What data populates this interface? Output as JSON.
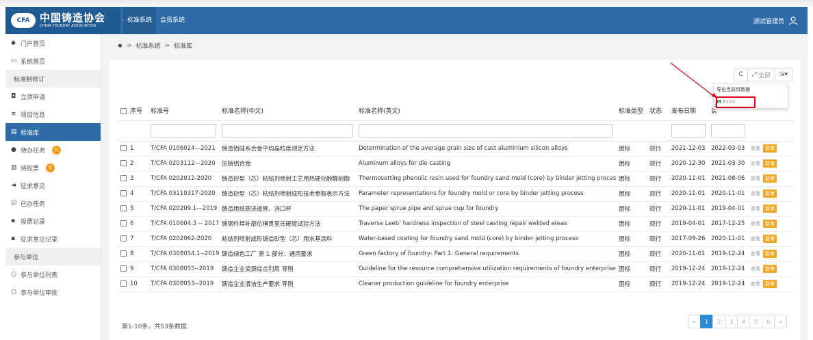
{
  "header": {
    "logo_mark": "CFA",
    "logo_cn": "中国铸造协会",
    "logo_en": "CHINA FOUNDRY ASSOCIATION",
    "collapse": "«",
    "nav": [
      "标准系统",
      "会员系统"
    ],
    "user": "测试管理员"
  },
  "sidebar": {
    "items": [
      {
        "label": "门户首页",
        "icon": "home-icon",
        "glyph": "◆"
      },
      {
        "label": "系统首页",
        "icon": "monitor-icon",
        "glyph": "▭"
      },
      {
        "label": "标准制修订",
        "group": true
      },
      {
        "label": "立项申请",
        "icon": "file-icon",
        "glyph": "◘"
      },
      {
        "label": "项目信息",
        "icon": "list-icon",
        "glyph": "≡"
      },
      {
        "label": "标准库",
        "icon": "book-icon",
        "glyph": "▤",
        "active": true
      },
      {
        "label": "待办任务",
        "icon": "info-icon",
        "glyph": "●",
        "badge": "0"
      },
      {
        "label": "待投票",
        "icon": "bar-chart-icon",
        "glyph": "▥",
        "badge": "0"
      },
      {
        "label": "征求意见",
        "icon": "send-icon",
        "glyph": "◄"
      },
      {
        "label": "已办任务",
        "icon": "check-icon",
        "glyph": "☑"
      },
      {
        "label": "投票记录",
        "icon": "doc-icon",
        "glyph": "▪"
      },
      {
        "label": "征求意见记录",
        "icon": "doc-icon",
        "glyph": "▪"
      },
      {
        "label": "参与单位",
        "group": true
      },
      {
        "label": "参与单位列表",
        "icon": "circle-icon",
        "glyph": "○"
      },
      {
        "label": "参与单位审批",
        "icon": "circle-icon",
        "glyph": "○"
      }
    ]
  },
  "breadcrumb": {
    "home_icon": "◆",
    "sep": ">",
    "items": [
      "标准系统",
      "标准库"
    ]
  },
  "toolbar": {
    "refresh": "C",
    "toggle_all": "全部",
    "export_glyph": "▾"
  },
  "dropdown": {
    "export_current": "导出当前页数据",
    "excel": "Excel",
    "excel_mark": "M",
    "marker": "3"
  },
  "table": {
    "headers": {
      "index": "序号",
      "code": "标准号",
      "name_cn": "标准名称(中文)",
      "name_en": "标准名称(英文)",
      "type": "标准类型",
      "status": "状态",
      "release": "发布日期",
      "implement": "实"
    },
    "view_label": "查看",
    "revise_label": "复审",
    "rows": [
      {
        "index": "1",
        "code": "T/CFA 0106024—2021",
        "name_cn": "铸造铝硅系合金平均晶粒度测定方法",
        "name_en": "Determination of the average grain size of cast aluminium silicon alloys",
        "type": "团标",
        "status": "现行",
        "release": "2021-12-03",
        "implement": "2022-03-03"
      },
      {
        "index": "2",
        "code": "T/CFA 0203112—2020",
        "name_cn": "压铸铝合金",
        "name_en": "Aluminum alloys for die casting",
        "type": "团标",
        "status": "现行",
        "release": "2020-12-30",
        "implement": "2021-03-30"
      },
      {
        "index": "3",
        "code": "T/CFA 0202012-2020",
        "name_cn": "铸造砂型（芯）粘结剂喷射工艺用热硬化酚醛树脂",
        "name_en": "Thermosetting phenolic resin used for foundry sand mold (core) by binder jetting process",
        "type": "团标",
        "status": "现行",
        "release": "2020-11-01",
        "implement": "2021-08-06"
      },
      {
        "index": "4",
        "code": "T/CFA 03110317-2020",
        "name_cn": "铸造砂型（芯）粘结剂喷射成形技术参数表示方法",
        "name_en": "Parameter representations for foundry mold or core by binder jetting process",
        "type": "团标",
        "status": "现行",
        "release": "2020-11-01",
        "implement": "2020-11-01"
      },
      {
        "index": "5",
        "code": "T/CFA 020209.1—2019",
        "name_cn": "铸造用纸质浇道管、浇口杯",
        "name_en": "The paper sprue pipe and sprue cup for foundry",
        "type": "团标",
        "status": "现行",
        "release": "2020-11-01",
        "implement": "2019-04-01"
      },
      {
        "index": "6",
        "code": "T/CFA 010604.3 -- 2017",
        "name_cn": "铸钢件焊补部位横贯里氏硬度试验方法",
        "name_en": "Traverse Leeb’ hardness inspection of steel casting repair welded areas",
        "type": "团标",
        "status": "现行",
        "release": "2019-04-01",
        "implement": "2017-12-25"
      },
      {
        "index": "7",
        "code": "T/CFA 0202062-2020",
        "name_cn": "粘结剂喷射成形铸造砂型（芯）用水基涂料",
        "name_en": "Water-based coating for foundry sand mold (core) by binder jetting process",
        "type": "团标",
        "status": "现行",
        "release": "2017-09-26",
        "implement": "2020-11-01"
      },
      {
        "index": "8",
        "code": "T/CFA 0308054.1--2019",
        "name_cn": "铸造绿色工厂 第 1 部分：通用要求",
        "name_en": "Green factory of foundry- Part 1: General requirements",
        "type": "团标",
        "status": "现行",
        "release": "2020-11-01",
        "implement": "2019-12-24"
      },
      {
        "index": "9",
        "code": "T/CFA 0308055--2019",
        "name_cn": "铸造企业资源综合利用 导则",
        "name_en": "Guideline for the resource comprehensive utilization requirements of foundry enterprises",
        "type": "团标",
        "status": "现行",
        "release": "2019-12-24",
        "implement": "2019-12-24"
      },
      {
        "index": "10",
        "code": "T/CFA 0308053--2019",
        "name_cn": "铸造企业清洁生产要求 导则",
        "name_en": "Cleaner production guideline for foundry enterprise",
        "type": "团标",
        "status": "现行",
        "release": "2019-12-24",
        "implement": "2019-12-24"
      }
    ]
  },
  "footer": {
    "range": "第1-10条，共53条数据.",
    "pager": {
      "prev": "«",
      "pages": [
        "1",
        "2",
        "3",
        "4",
        "5",
        "6"
      ],
      "next": "»",
      "current": "1"
    }
  },
  "colors": {
    "brand": "#2d6ca8",
    "accent": "#f5a623",
    "highlight": "#d9001b",
    "excel": "#1e8b3c"
  }
}
